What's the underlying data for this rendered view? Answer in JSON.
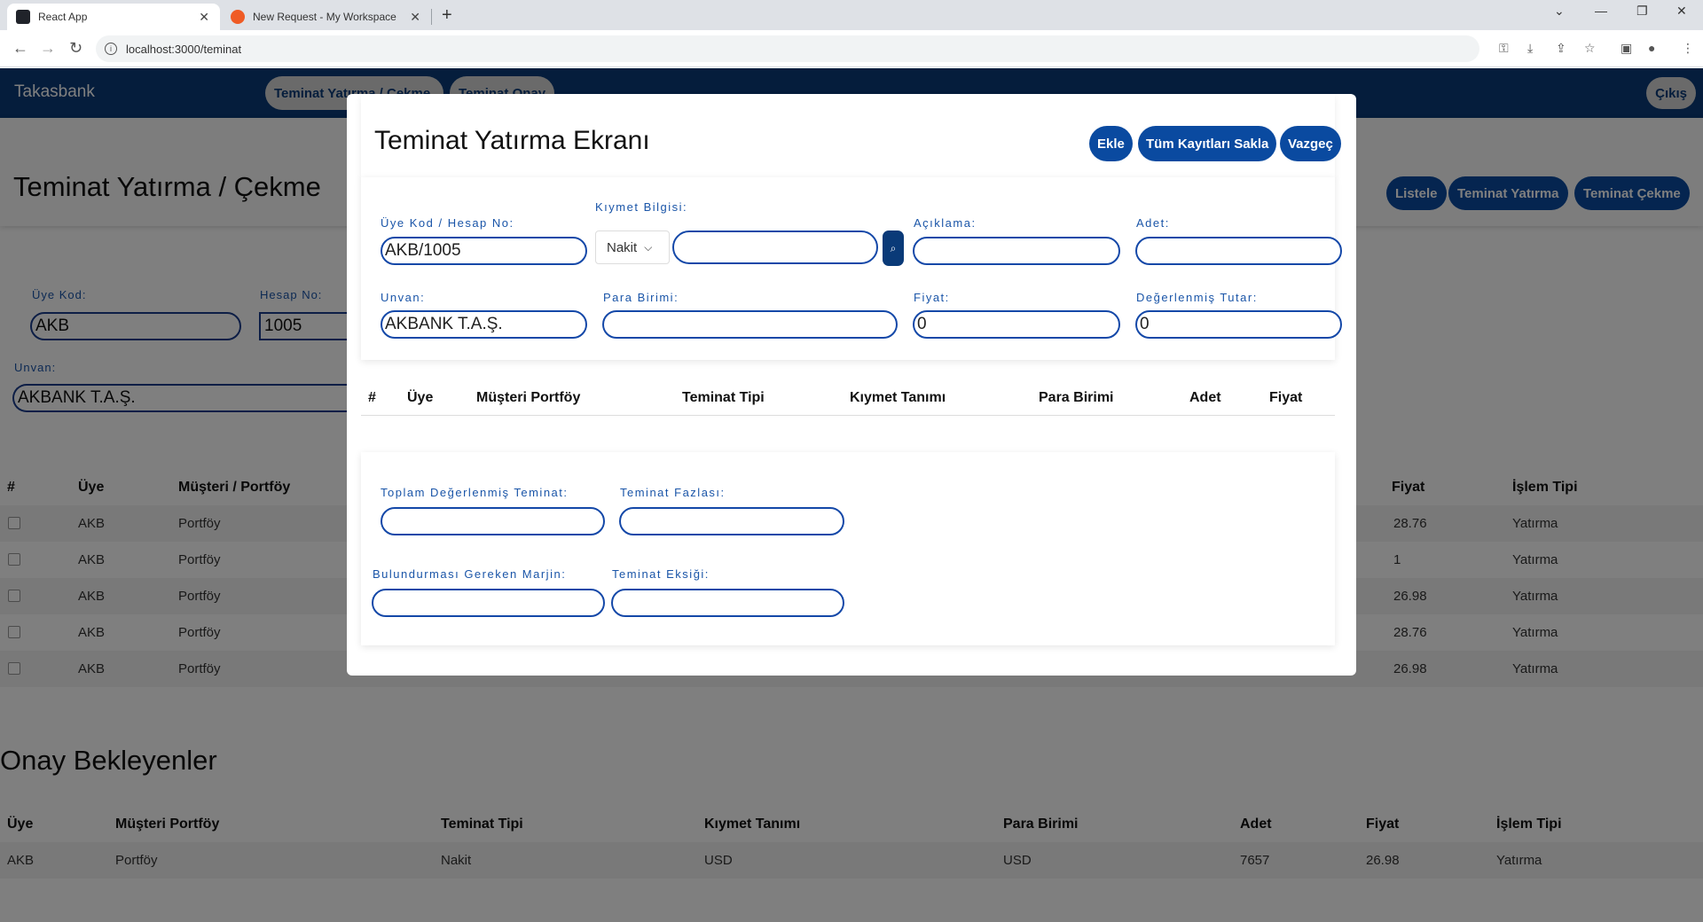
{
  "browser": {
    "tabs": [
      {
        "title": "React App",
        "active": true
      },
      {
        "title": "New Request - My Workspace",
        "active": false
      }
    ],
    "url": "localhost:3000/teminat"
  },
  "app": {
    "brand": "Takasbank",
    "nav": [
      "Teminat Yatırma / Çekme",
      "Teminat Onay"
    ],
    "logout": "Çıkış",
    "page_title": "Teminat Yatırma / Çekme",
    "header_buttons": [
      "Listele",
      "Teminat Yatırma",
      "Teminat Çekme"
    ],
    "form": {
      "uye_kod_label": "Üye Kod:",
      "uye_kod_value": "AKB",
      "hesap_no_label": "Hesap No:",
      "hesap_no_value": "1005",
      "unvan_label": "Unvan:",
      "unvan_value": "AKBANK T.A.Ş."
    },
    "table": {
      "headers": [
        "#",
        "Üye",
        "Müşteri / Portföy",
        "Fiyat",
        "İşlem Tipi"
      ],
      "rows": [
        {
          "uye": "AKB",
          "portfoy": "Portföy",
          "fiyat": "28.76",
          "islem": "Yatırma"
        },
        {
          "uye": "AKB",
          "portfoy": "Portföy",
          "fiyat": "1",
          "islem": "Yatırma"
        },
        {
          "uye": "AKB",
          "portfoy": "Portföy",
          "fiyat": "26.98",
          "islem": "Yatırma"
        },
        {
          "uye": "AKB",
          "portfoy": "Portföy",
          "fiyat": "28.76",
          "islem": "Yatırma"
        },
        {
          "uye": "AKB",
          "portfoy": "Portföy",
          "fiyat": "26.98",
          "islem": "Yatırma"
        }
      ]
    },
    "pending": {
      "title": "Onay Bekleyenler",
      "headers": [
        "Üye",
        "Müşteri Portföy",
        "Teminat Tipi",
        "Kıymet Tanımı",
        "Para Birimi",
        "Adet",
        "Fiyat",
        "İşlem Tipi"
      ],
      "rows": [
        [
          "AKB",
          "Portföy",
          "Nakit",
          "USD",
          "USD",
          "7657",
          "26.98",
          "Yatırma"
        ]
      ]
    }
  },
  "modal": {
    "title": "Teminat Yatırma Ekranı",
    "buttons": {
      "add": "Ekle",
      "save_all": "Tüm Kayıtları Sakla",
      "cancel": "Vazgeç"
    },
    "fields": {
      "uye_hesap_label": "Üye Kod / Hesap No:",
      "uye_hesap_value": "AKB/1005",
      "kiymet_label": "Kıymet Bilgisi:",
      "kiymet_select": "Nakit",
      "kiymet_value": "",
      "aciklama_label": "Açıklama:",
      "adet_label": "Adet:",
      "unvan_label": "Unvan:",
      "unvan_value": "AKBANK T.A.Ş.",
      "para_label": "Para Birimi:",
      "fiyat_label": "Fiyat:",
      "fiyat_value": "0",
      "degerlenmis_label": "Değerlenmiş Tutar:",
      "degerlenmis_value": "0"
    },
    "table_headers": [
      "#",
      "Üye",
      "Müşteri Portföy",
      "Teminat Tipi",
      "Kıymet Tanımı",
      "Para Birimi",
      "Adet",
      "Fiyat"
    ],
    "summary": {
      "toplam_label": "Toplam Değerlenmiş Teminat:",
      "fazlasi_label": "Teminat Fazlası:",
      "marjin_label": "Bulundurması Gereken Marjin:",
      "eksigi_label": "Teminat Eksiği:"
    }
  },
  "colors": {
    "nav": "#0a3a78",
    "button": "#0a4aa0",
    "label": "#1a55a8"
  }
}
